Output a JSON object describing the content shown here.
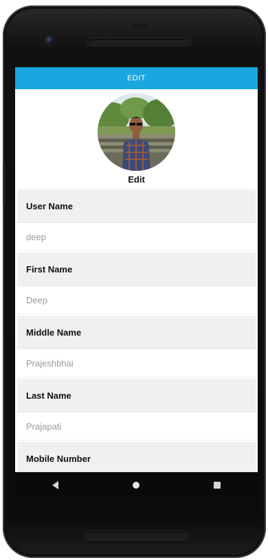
{
  "app_bar": {
    "title": "EDIT"
  },
  "profile": {
    "photo_edit_label": "Edit"
  },
  "fields": [
    {
      "label": "User Name",
      "value": "deep"
    },
    {
      "label": "First Name",
      "value": "Deep"
    },
    {
      "label": "Middle Name",
      "value": "Prajeshbhai"
    },
    {
      "label": "Last Name",
      "value": "Prajapati"
    },
    {
      "label": "Mobile Number",
      "value": ""
    }
  ],
  "colors": {
    "app_bar": "#1aa6df",
    "label_bg": "#f0f0f0",
    "value_text": "#9a9a9a"
  },
  "nav_icons": [
    "back-icon",
    "home-icon",
    "recents-icon"
  ]
}
